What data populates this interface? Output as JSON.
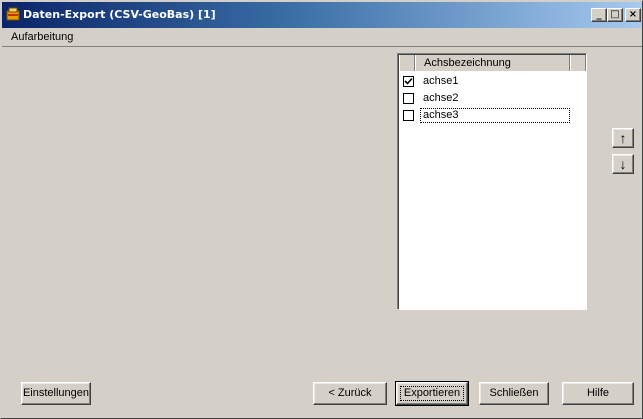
{
  "window": {
    "title": "Daten-Export (CSV-GeoBas) [1]",
    "controls": {
      "minimize": "_",
      "maximize": "□",
      "close": "×"
    }
  },
  "menubar": {
    "items": [
      {
        "label": "Aufarbeitung"
      }
    ]
  },
  "grid": {
    "column_header": "Achsbezeichnung",
    "rows": [
      {
        "label": "achse1",
        "checked": true
      },
      {
        "label": "achse2",
        "checked": false
      },
      {
        "label": "achse3",
        "checked": false,
        "focused": true
      }
    ]
  },
  "side_buttons": {
    "move_up_icon": "↑",
    "move_down_icon": "↓"
  },
  "footer": {
    "settings_label": "Einstellungen",
    "back_label": "< Zurück",
    "export_label": "Exportieren",
    "close_label": "Schließen",
    "help_label": "Hilfe"
  },
  "colors": {
    "titlebar_start": "#0a246a",
    "titlebar_end": "#a6caf0",
    "face": "#d4d0c8"
  }
}
